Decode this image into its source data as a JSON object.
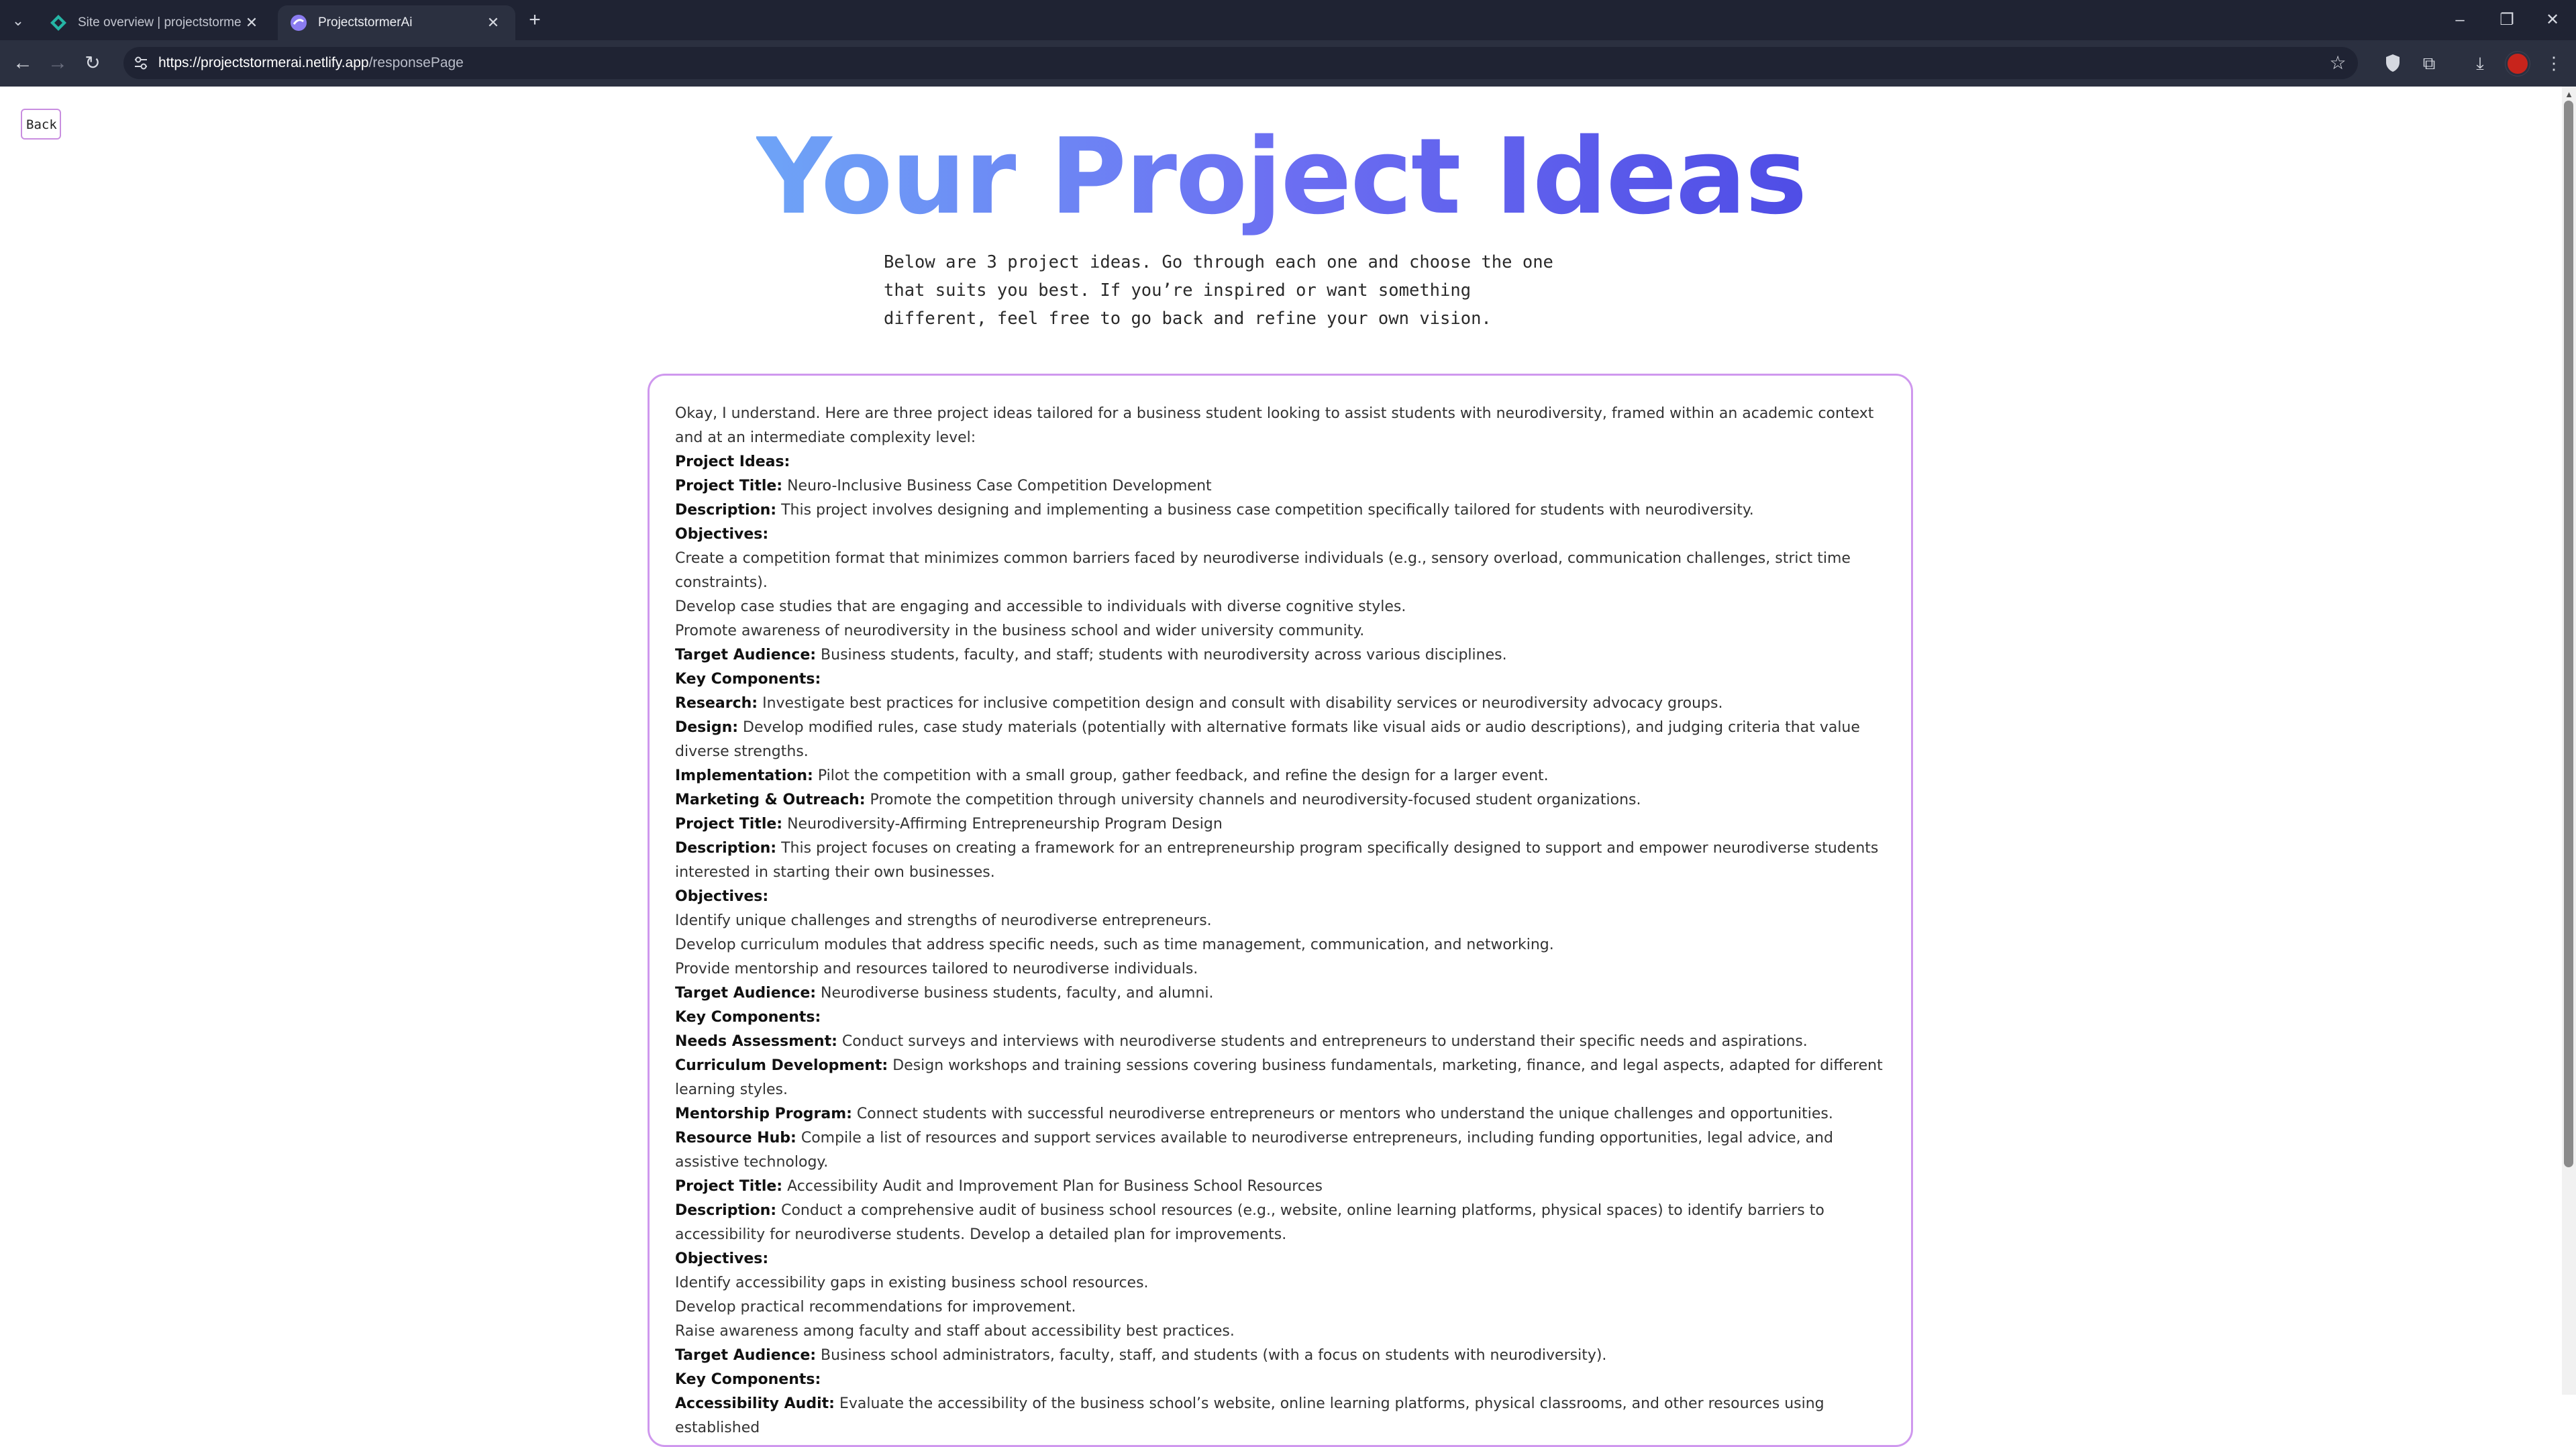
{
  "browser": {
    "tabs": [
      {
        "title": "Site overview | projectstormerai",
        "active": false
      },
      {
        "title": "ProjectstormerAi",
        "active": true
      }
    ],
    "url": {
      "host": "https://projectstormerai.netlify.app",
      "path": "/responsePage"
    }
  },
  "page": {
    "back_label": "Back",
    "title": "Your Project Ideas",
    "intro_lines": [
      "Below are 3 project ideas. Go through each one and choose the one",
      "that suits you best. If you’re inspired or want something",
      "different, feel free to go back and refine your own vision."
    ],
    "response": [
      {
        "label": "",
        "text": "Okay, I understand. Here are three project ideas tailored for a business student looking to assist students with neurodiversity, framed within an academic context and at an intermediate complexity level:"
      },
      {
        "label": "Project Ideas:",
        "text": ""
      },
      {
        "label": "Project Title:",
        "text": "Neuro-Inclusive Business Case Competition Development"
      },
      {
        "label": "Description:",
        "text": "This project involves designing and implementing a business case competition specifically tailored for students with neurodiversity."
      },
      {
        "label": "Objectives:",
        "text": ""
      },
      {
        "label": "",
        "text": "Create a competition format that minimizes common barriers faced by neurodiverse individuals (e.g., sensory overload, communication challenges, strict time constraints)."
      },
      {
        "label": "",
        "text": "Develop case studies that are engaging and accessible to individuals with diverse cognitive styles."
      },
      {
        "label": "",
        "text": "Promote awareness of neurodiversity in the business school and wider university community."
      },
      {
        "label": "Target Audience:",
        "text": "Business students, faculty, and staff; students with neurodiversity across various disciplines."
      },
      {
        "label": "Key Components:",
        "text": ""
      },
      {
        "label": "Research:",
        "text": "Investigate best practices for inclusive competition design and consult with disability services or neurodiversity advocacy groups."
      },
      {
        "label": "Design:",
        "text": "Develop modified rules, case study materials (potentially with alternative formats like visual aids or audio descriptions), and judging criteria that value diverse strengths."
      },
      {
        "label": "Implementation:",
        "text": "Pilot the competition with a small group, gather feedback, and refine the design for a larger event."
      },
      {
        "label": "Marketing & Outreach:",
        "text": "Promote the competition through university channels and neurodiversity-focused student organizations."
      },
      {
        "label": "Project Title:",
        "text": "Neurodiversity-Affirming Entrepreneurship Program Design"
      },
      {
        "label": "Description:",
        "text": "This project focuses on creating a framework for an entrepreneurship program specifically designed to support and empower neurodiverse students interested in starting their own businesses."
      },
      {
        "label": "Objectives:",
        "text": ""
      },
      {
        "label": "",
        "text": "Identify unique challenges and strengths of neurodiverse entrepreneurs."
      },
      {
        "label": "",
        "text": "Develop curriculum modules that address specific needs, such as time management, communication, and networking."
      },
      {
        "label": "",
        "text": "Provide mentorship and resources tailored to neurodiverse individuals."
      },
      {
        "label": "Target Audience:",
        "text": "Neurodiverse business students, faculty, and alumni."
      },
      {
        "label": "Key Components:",
        "text": ""
      },
      {
        "label": "Needs Assessment:",
        "text": "Conduct surveys and interviews with neurodiverse students and entrepreneurs to understand their specific needs and aspirations."
      },
      {
        "label": "Curriculum Development:",
        "text": "Design workshops and training sessions covering business fundamentals, marketing, finance, and legal aspects, adapted for different learning styles."
      },
      {
        "label": "Mentorship Program:",
        "text": "Connect students with successful neurodiverse entrepreneurs or mentors who understand the unique challenges and opportunities."
      },
      {
        "label": "Resource Hub:",
        "text": "Compile a list of resources and support services available to neurodiverse entrepreneurs, including funding opportunities, legal advice, and assistive technology."
      },
      {
        "label": "Project Title:",
        "text": "Accessibility Audit and Improvement Plan for Business School Resources"
      },
      {
        "label": "Description:",
        "text": "Conduct a comprehensive audit of business school resources (e.g., website, online learning platforms, physical spaces) to identify barriers to accessibility for neurodiverse students. Develop a detailed plan for improvements."
      },
      {
        "label": "Objectives:",
        "text": ""
      },
      {
        "label": "",
        "text": "Identify accessibility gaps in existing business school resources."
      },
      {
        "label": "",
        "text": "Develop practical recommendations for improvement."
      },
      {
        "label": "",
        "text": "Raise awareness among faculty and staff about accessibility best practices."
      },
      {
        "label": "Target Audience:",
        "text": "Business school administrators, faculty, staff, and students (with a focus on students with neurodiversity)."
      },
      {
        "label": "Key Components:",
        "text": ""
      },
      {
        "label": "Accessibility Audit:",
        "text": "Evaluate the accessibility of the business school’s website, online learning platforms, physical classrooms, and other resources using established"
      }
    ]
  },
  "colors": {
    "title_gradient": [
      "#6ea4f7",
      "#6c6ff2",
      "#4f4de6"
    ],
    "card_border": "#cf98ee",
    "chrome_dark": "#1f2333",
    "chrome_toolbar": "#2b3040"
  }
}
